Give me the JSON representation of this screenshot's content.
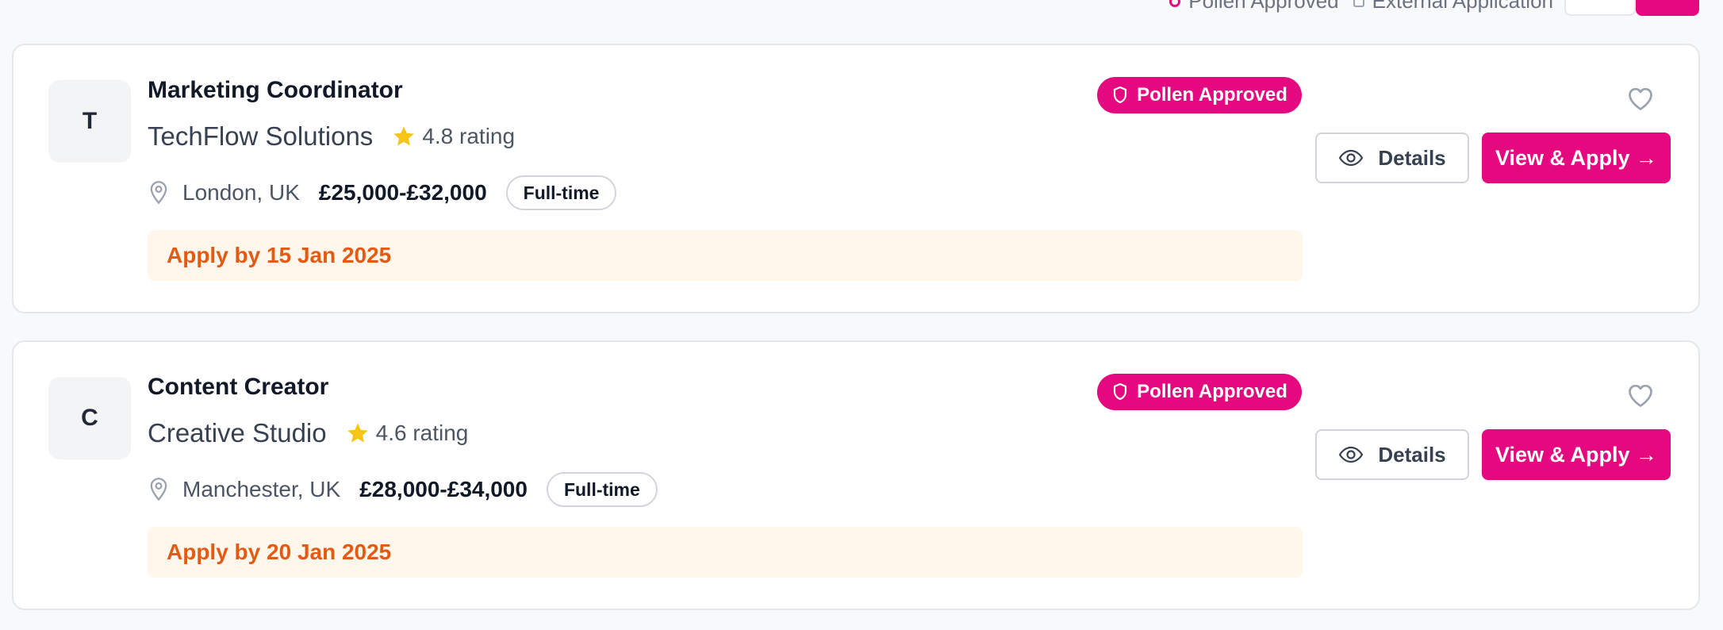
{
  "topbar": {
    "left_text": "",
    "legend": [
      {
        "label": "Pollen Approved",
        "icon": "pink-dot-icon"
      },
      {
        "label": "External Application",
        "icon": "external-square-icon"
      }
    ],
    "views": [
      "list-view-icon",
      "grid-view-icon"
    ]
  },
  "colors": {
    "accent": "#e5097f",
    "deadline_text": "#e45a12",
    "deadline_bg": "#fff6ec",
    "star": "#f5c518"
  },
  "jobs": [
    {
      "avatar_initial": "T",
      "title": "Marketing Coordinator",
      "company": "TechFlow Solutions",
      "rating": "4.8 rating",
      "location": "London, UK",
      "salary": "£25,000-£32,000",
      "job_type": "Full-time",
      "deadline": "Apply by 15 Jan 2025",
      "badge": "Pollen Approved",
      "details_label": "Details",
      "apply_label": "View & Apply →"
    },
    {
      "avatar_initial": "C",
      "title": "Content Creator",
      "company": "Creative Studio",
      "rating": "4.6 rating",
      "location": "Manchester, UK",
      "salary": "£28,000-£34,000",
      "job_type": "Full-time",
      "deadline": "Apply by 20 Jan 2025",
      "badge": "Pollen Approved",
      "details_label": "Details",
      "apply_label": "View & Apply →"
    }
  ]
}
